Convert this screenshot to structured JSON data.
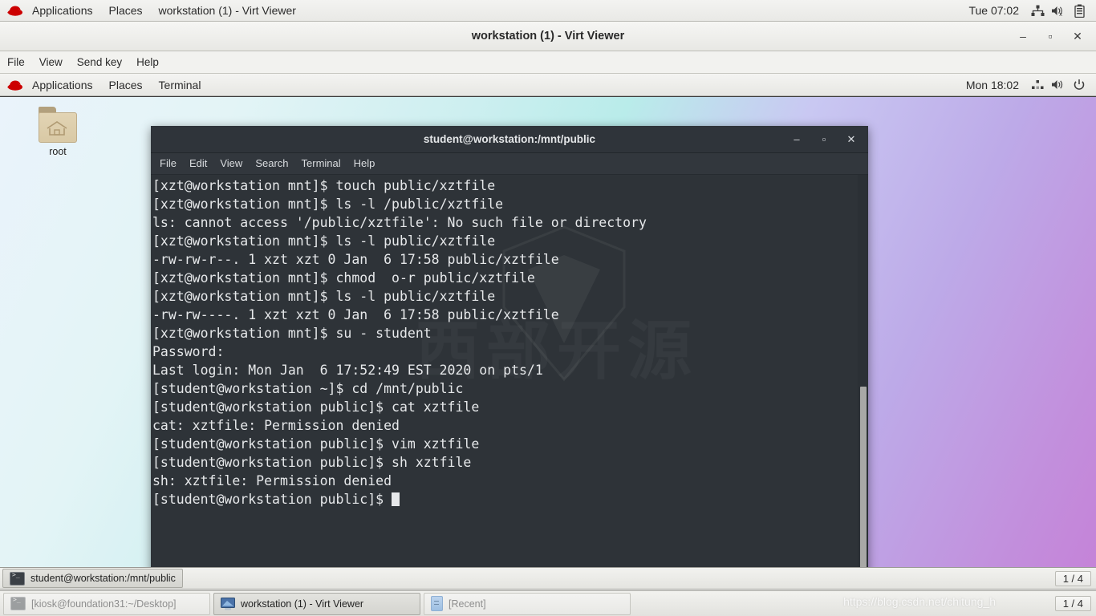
{
  "host_panel": {
    "logo_icon": "redhat-logo-icon",
    "items": [
      "Applications",
      "Places",
      "workstation (1) - Virt Viewer"
    ],
    "clock": "Tue 07:02",
    "tray": [
      "network-icon",
      "volume-muted-icon",
      "battery-icon"
    ]
  },
  "virt_viewer": {
    "title": "workstation (1) - Virt Viewer",
    "window_buttons": {
      "minimize": "–",
      "maximize": "▫",
      "close": "✕"
    },
    "menu": [
      "File",
      "View",
      "Send key",
      "Help"
    ]
  },
  "guest_panel": {
    "logo_icon": "redhat-logo-icon",
    "items": [
      "Applications",
      "Places",
      "Terminal"
    ],
    "clock": "Mon 18:02",
    "tray": [
      "network-icon",
      "volume-icon",
      "power-icon"
    ]
  },
  "desktop": {
    "icons": [
      {
        "label": "root",
        "icon": "home-folder-icon"
      }
    ]
  },
  "terminal": {
    "title": "student@workstation:/mnt/public",
    "window_buttons": {
      "minimize": "–",
      "maximize": "▫",
      "close": "✕"
    },
    "menu": [
      "File",
      "Edit",
      "View",
      "Search",
      "Terminal",
      "Help"
    ],
    "watermark": "西部开源",
    "lines": [
      "[xzt@workstation mnt]$ touch public/xztfile",
      "[xzt@workstation mnt]$ ls -l /public/xztfile",
      "ls: cannot access '/public/xztfile': No such file or directory",
      "[xzt@workstation mnt]$ ls -l public/xztfile",
      "-rw-rw-r--. 1 xzt xzt 0 Jan  6 17:58 public/xztfile",
      "[xzt@workstation mnt]$ chmod  o-r public/xztfile",
      "[xzt@workstation mnt]$ ls -l public/xztfile",
      "-rw-rw----. 1 xzt xzt 0 Jan  6 17:58 public/xztfile",
      "[xzt@workstation mnt]$ su - student",
      "Password:",
      "Last login: Mon Jan  6 17:52:49 EST 2020 on pts/1",
      "[student@workstation ~]$ cd /mnt/public",
      "[student@workstation public]$ cat xztfile",
      "cat: xztfile: Permission denied",
      "[student@workstation public]$ vim xztfile",
      "[student@workstation public]$ sh xztfile",
      "sh: xztfile: Permission denied"
    ],
    "prompt": "[student@workstation public]$ "
  },
  "guest_taskbar": {
    "buttons": [
      {
        "label": "student@workstation:/mnt/public",
        "icon": "terminal-icon",
        "state": "active"
      }
    ],
    "workspace": "1 / 4"
  },
  "host_taskbar": {
    "buttons": [
      {
        "label": "[kiosk@foundation31:~/Desktop]",
        "icon": "terminal-icon",
        "state": "minimized"
      },
      {
        "label": "workstation (1) - Virt Viewer",
        "icon": "monitor-icon",
        "state": "active"
      },
      {
        "label": "[Recent]",
        "icon": "recent-icon",
        "state": "minimized"
      }
    ],
    "workspace": "1 / 4"
  },
  "watermark": "https://blog.csdn.net/chitung_h",
  "colors": {
    "terminal_bg": "#2e3338",
    "terminal_fg": "#e6e8ea",
    "panel_bg": "#f2f2ef",
    "accent_red": "#cc0000"
  }
}
